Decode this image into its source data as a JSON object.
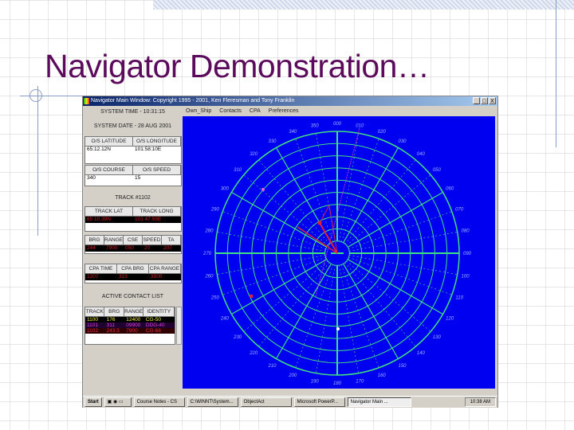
{
  "slide": {
    "title": "Navigator Demonstration…"
  },
  "window": {
    "title": "Navigator Main Window: Copyright 1995 - 2001, Ken Fleresman and Tony Franklin",
    "controls": [
      "_",
      "□",
      "X"
    ],
    "menu": [
      "Own_Ship",
      "Contacts",
      "CPA",
      "Preferences"
    ],
    "system_time": "SYSTEM TIME - 10:31:15",
    "system_date": "SYSTEM DATE - 28 AUG 2001",
    "own_pos": {
      "headers": [
        "O/S LATITUDE",
        "O/S LONGITUDE"
      ],
      "values": [
        "65:12.12N",
        "101:58:10E"
      ]
    },
    "own_motion": {
      "headers": [
        "O/S COURSE",
        "O/S SPEED"
      ],
      "values": [
        "340",
        "15"
      ]
    },
    "track_label": "TRACK #1102",
    "track_pos": {
      "headers": [
        "TRACK LAT",
        "TRACK LONG"
      ],
      "values": [
        "65 10.39N",
        "101 47.59E"
      ]
    },
    "track_data": {
      "headers": [
        "BRG",
        "RANGE",
        "CSE",
        "SPEED",
        "TA"
      ],
      "values": [
        "244",
        "7900",
        "050",
        "20",
        "207"
      ]
    },
    "cpa": {
      "headers": [
        "CPA TIME",
        "CPA BRG",
        "CPA RANGE"
      ],
      "values": [
        "1207",
        "323",
        "3500"
      ]
    },
    "contact_list_label": "ACTIVE CONTACT LIST",
    "contacts": {
      "headers": [
        "TRACK",
        "BRG",
        "RANGE",
        "IDENTITY"
      ],
      "rows": [
        [
          "1100",
          "176",
          "12400",
          "CG-50"
        ],
        [
          "1101",
          "311",
          "09900",
          "DDG-40"
        ],
        [
          "1102",
          "243.5",
          "7900",
          "CG-66"
        ]
      ],
      "row_colors": [
        {
          "text": "#f0f040",
          "bg": "#000000"
        },
        {
          "text": "#e040e0",
          "bg": "#200030"
        },
        {
          "text": "#e03040",
          "bg": "#300000"
        }
      ]
    },
    "radar": {
      "background": "#0000f0",
      "grid_color": "#40e080",
      "bearing_labels_step": 10
    }
  },
  "taskbar": {
    "items": [
      "Start",
      "Course Notes - CS",
      "C:\\WINNT\\System...",
      "ObjectAct",
      "Microsoft PowerP...",
      "Navigator Main ..."
    ],
    "active": 5,
    "clock": "10:38 AM"
  }
}
